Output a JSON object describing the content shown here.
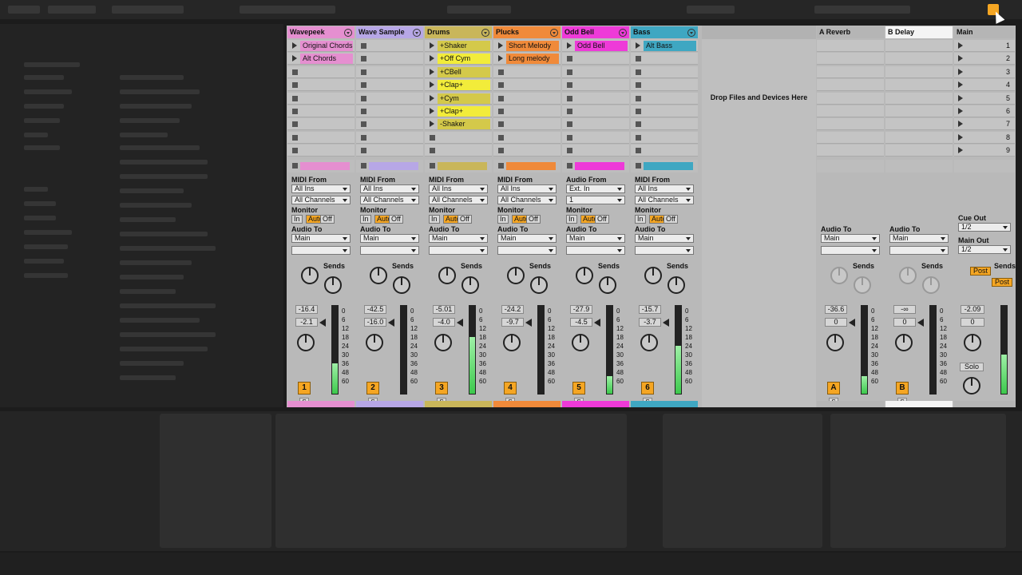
{
  "tracks": [
    {
      "name": "Wavepeek",
      "color": "#e58fd0",
      "clips": [
        {
          "label": "Original Chords",
          "color": "#e58fd0"
        },
        {
          "label": "Alt Chords",
          "color": "#e58fd0"
        }
      ],
      "io": {
        "from_label": "MIDI From",
        "from": "All Ins",
        "channel": "All Channels",
        "monitor_label": "Monitor",
        "monitor": [
          "In",
          "Auto",
          "Off"
        ],
        "to_label": "Audio To",
        "to": "Main"
      },
      "sends": "Sends",
      "vol": "-16.4",
      "pan": "-2.1",
      "num": "1",
      "meter": 0.35
    },
    {
      "name": "Wave Sample",
      "color": "#b7a7e6",
      "clips": [],
      "io": {
        "from_label": "MIDI From",
        "from": "All Ins",
        "channel": "All Channels",
        "monitor_label": "Monitor",
        "monitor": [
          "In",
          "Auto",
          "Off"
        ],
        "to_label": "Audio To",
        "to": "Main"
      },
      "sends": "Sends",
      "vol": "-42.5",
      "pan": "-16.0",
      "num": "2",
      "meter": 0
    },
    {
      "name": "Drums",
      "color": "#c9b65a",
      "clips": [
        {
          "label": "+Shaker",
          "color": "#d4c94a"
        },
        {
          "label": "+Off Cym",
          "color": "#f2ec3a"
        },
        {
          "label": "+CBell",
          "color": "#d4c94a"
        },
        {
          "label": "+Clap+",
          "color": "#f2ec3a"
        },
        {
          "label": "+Cym",
          "color": "#d4c94a"
        },
        {
          "label": "+Clap+",
          "color": "#f2ec3a"
        },
        {
          "label": "-Shaker",
          "color": "#d4c94a"
        }
      ],
      "io": {
        "from_label": "MIDI From",
        "from": "All Ins",
        "channel": "All Channels",
        "monitor_label": "Monitor",
        "monitor": [
          "In",
          "Auto",
          "Off"
        ],
        "to_label": "Audio To",
        "to": "Main"
      },
      "sends": "Sends",
      "vol": "-5.01",
      "pan": "-4.0",
      "num": "3",
      "meter": 0.65
    },
    {
      "name": "Plucks",
      "color": "#f08a3a",
      "clips": [
        {
          "label": "Short Melody",
          "color": "#f08a3a"
        },
        {
          "label": "Long melody",
          "color": "#f08a3a"
        }
      ],
      "io": {
        "from_label": "MIDI From",
        "from": "All Ins",
        "channel": "All Channels",
        "monitor_label": "Monitor",
        "monitor": [
          "In",
          "Auto",
          "Off"
        ],
        "to_label": "Audio To",
        "to": "Main"
      },
      "sends": "Sends",
      "vol": "-24.2",
      "pan": "-9.7",
      "num": "4",
      "meter": 0
    },
    {
      "name": "Odd Bell",
      "color": "#ee3ad8",
      "clips": [
        {
          "label": "Odd Bell",
          "color": "#ee3ad8"
        }
      ],
      "io": {
        "from_label": "Audio From",
        "from": "Ext. In",
        "channel": "1",
        "monitor_label": "Monitor",
        "monitor": [
          "In",
          "Auto",
          "Off"
        ],
        "to_label": "Audio To",
        "to": "Main"
      },
      "sends": "Sends",
      "vol": "-27.9",
      "pan": "-4.5",
      "num": "5",
      "meter": 0.2
    },
    {
      "name": "Bass",
      "color": "#3fa7c2",
      "clips": [
        {
          "label": "Alt Bass",
          "color": "#3fa7c2"
        }
      ],
      "io": {
        "from_label": "MIDI From",
        "from": "All Ins",
        "channel": "All Channels",
        "monitor_label": "Monitor",
        "monitor": [
          "In",
          "Auto",
          "Off"
        ],
        "to_label": "Audio To",
        "to": "Main"
      },
      "sends": "Sends",
      "vol": "-15.7",
      "pan": "-3.7",
      "num": "6",
      "meter": 0.55
    }
  ],
  "drop_text": "Drop Files and Devices Here",
  "returns": [
    {
      "name": "A Reverb",
      "to_label": "Audio To",
      "to": "Main",
      "sends": "Sends",
      "vol": "-36.6",
      "pan": "0",
      "num": "A",
      "meter": 0.2
    },
    {
      "name": "B Delay",
      "to_label": "Audio To",
      "to": "Main",
      "sends": "Sends",
      "vol": "-∞",
      "pan": "0",
      "num": "B",
      "meter": 0
    }
  ],
  "master": {
    "name": "Main",
    "scenes": [
      "1",
      "2",
      "3",
      "4",
      "5",
      "6",
      "7",
      "8",
      "9"
    ],
    "cue_label": "Cue Out",
    "cue": "1/2",
    "main_out_label": "Main Out",
    "main_out": "1/2",
    "sends": "Sends",
    "post": "Post",
    "vol": "-2.09",
    "pan": "0",
    "solo": "Solo",
    "meter": 0.45
  },
  "scale": [
    "0",
    "6",
    "12",
    "18",
    "24",
    "30",
    "36",
    "48",
    "60"
  ],
  "small_s": "S",
  "colors": {
    "accent": "#f5a623",
    "meter": "#3cc94c"
  }
}
